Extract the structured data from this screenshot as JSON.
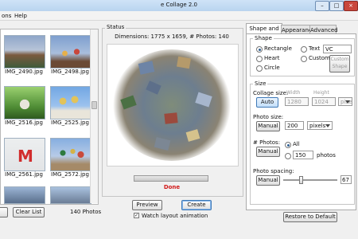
{
  "window": {
    "title": "e Collage 2.0",
    "minimize_icon": "minimize-icon",
    "maximize_icon": "maximize-icon",
    "close_icon": "close-icon"
  },
  "menu": {
    "items": [
      "ons",
      "Help"
    ]
  },
  "left_panel": {
    "photos": [
      {
        "name": "IMG_2490.jpg"
      },
      {
        "name": "IMG_2498.jpg"
      },
      {
        "name": "IMG_2516.jpg"
      },
      {
        "name": "IMG_2525.jpg"
      },
      {
        "name": "IMG_2561.jpg"
      },
      {
        "name": "IMG_2572.jpg"
      }
    ],
    "clear_list_label": "Clear List",
    "photo_count": "140 Photos",
    "remove_label": ""
  },
  "status": {
    "group_label": "Status",
    "dimensions_text": "Dimensions: 1775 x 1659, # Photos: 140",
    "progress": 1.0,
    "done_text": "Done",
    "done_color": "#d11a1a",
    "preview_label": "Preview",
    "create_label": "Create",
    "watch_label": "Watch layout animation",
    "watch_checked": true
  },
  "right_panel": {
    "tabs": [
      "Shape and Size",
      "Appearance",
      "Advanced"
    ],
    "active_tab": 0,
    "shape": {
      "label": "Shape",
      "options": {
        "rectangle": "Rectangle",
        "heart": "Heart",
        "circle": "Circle",
        "text": "Text",
        "custom": "Custom"
      },
      "selected": "rectangle",
      "text_value": "VC",
      "custom_shape_label": "Custom Shape"
    },
    "size": {
      "label": "Size",
      "collage_size_label": "Collage size:",
      "auto_label": "Auto",
      "width_label": "Width",
      "height_label": "Height",
      "width_value": "1280",
      "height_value": "1024",
      "units_value": "pixels",
      "photo_size_label": "Photo size:",
      "manual_label": "Manual",
      "photo_size_value": "200",
      "photo_size_units": "pixels",
      "num_photos_label": "# Photos:",
      "num_manual_label": "Manual",
      "all_label": "All",
      "count_value": "150",
      "photos_label": "photos",
      "num_selected": "all",
      "spacing_label": "Photo spacing:",
      "spacing_manual_label": "Manual",
      "spacing_value": "67",
      "spacing_fraction": 0.3
    },
    "restore_label": "Restore to Default"
  }
}
